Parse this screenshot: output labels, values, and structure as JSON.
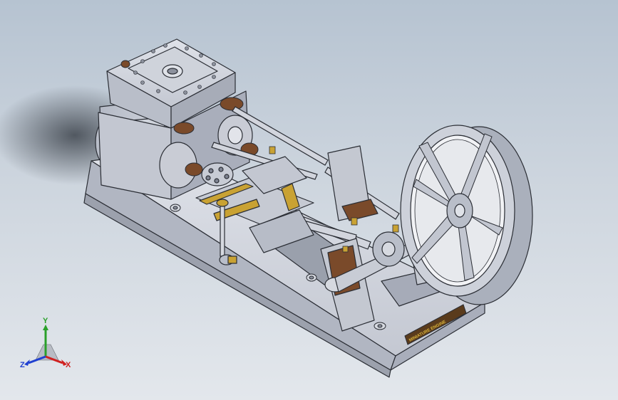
{
  "viewport": {
    "background_top": "#b6c3d1",
    "background_bottom": "#e3e7ec",
    "part_color": "#c4c8d2",
    "part_shadow": "#8f95a2",
    "bronze_color": "#7a4a2a",
    "brass_color": "#c9a233"
  },
  "name_plate": {
    "text": "MINIATURE ENGINE"
  },
  "triad": {
    "y_label": "Y",
    "x_label": "X",
    "z_label": "Z",
    "y_color": "#2aa02a",
    "x_color": "#d02020",
    "z_color": "#2040d0"
  }
}
